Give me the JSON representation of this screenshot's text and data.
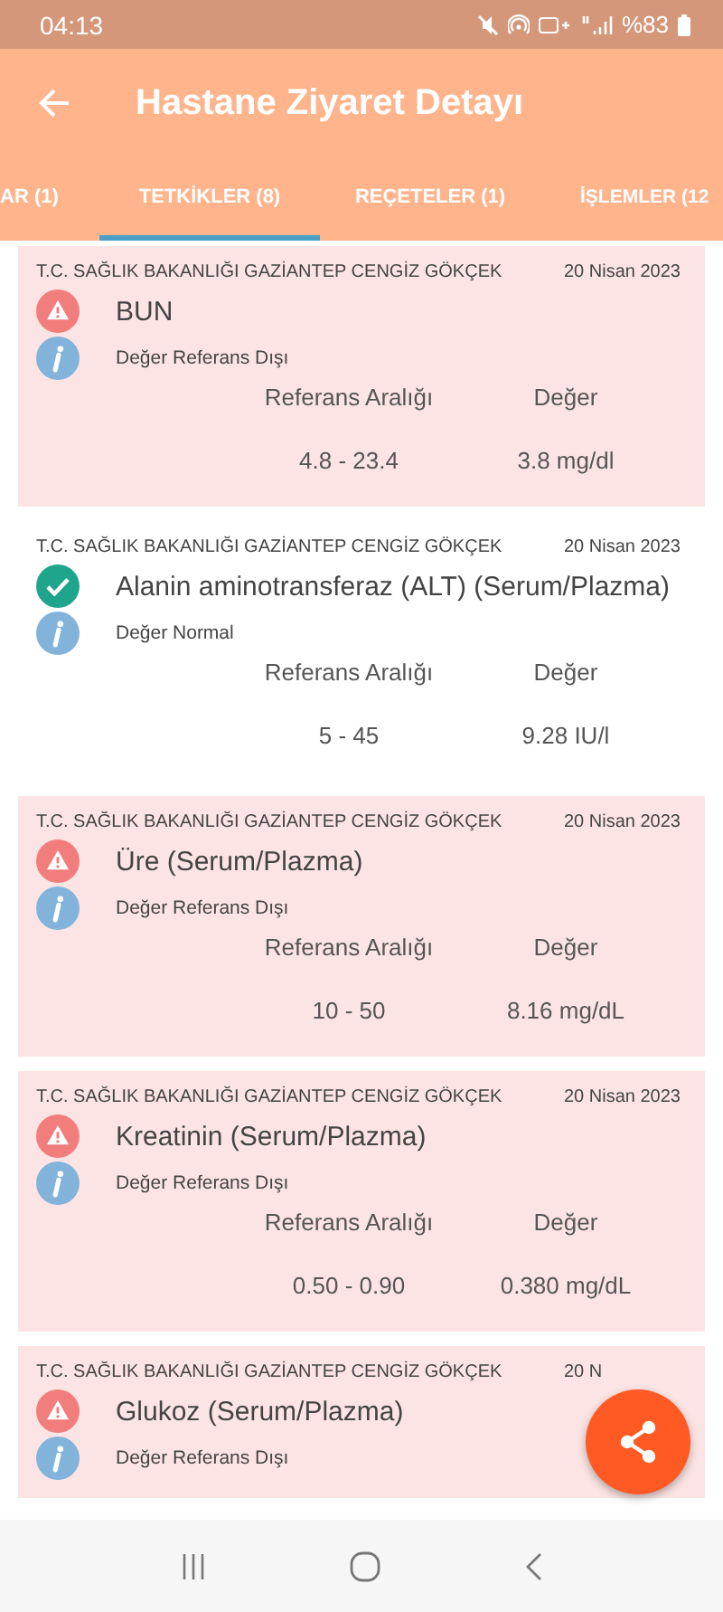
{
  "status_bar": {
    "time": "04:13",
    "battery": "%83"
  },
  "app_bar": {
    "title": "Hastane Ziyaret Detayı"
  },
  "tabs": [
    {
      "label": "AR (1)",
      "selected": false
    },
    {
      "label": "TETKİKLER (8)",
      "selected": true
    },
    {
      "label": "REÇETELER (1)",
      "selected": false
    },
    {
      "label": "İŞLEMLER (12",
      "selected": false
    }
  ],
  "results": [
    {
      "hospital": "T.C. SAĞLIK BAKANLIĞI GAZİANTEP CENGİZ GÖKÇEK",
      "date": "20 Nisan 2023",
      "test": "BUN",
      "kind": "warning",
      "status": "Değer Referans Dışı",
      "range_label": "Referans Aralığı",
      "value_label": "Değer",
      "range": "4.8 - 23.4",
      "value": "3.8 mg/dl"
    },
    {
      "hospital": "T.C. SAĞLIK BAKANLIĞI GAZİANTEP CENGİZ GÖKÇEK",
      "date": "20 Nisan 2023",
      "test": "Alanin aminotransferaz (ALT) (Serum/Plazma)",
      "kind": "normal",
      "status": "Değer Normal",
      "range_label": "Referans Aralığı",
      "value_label": "Değer",
      "range": "5 - 45",
      "value": "9.28 IU/l"
    },
    {
      "hospital": "T.C. SAĞLIK BAKANLIĞI GAZİANTEP CENGİZ GÖKÇEK",
      "date": "20 Nisan 2023",
      "test": "Üre (Serum/Plazma)",
      "kind": "warning",
      "status": "Değer Referans Dışı",
      "range_label": "Referans Aralığı",
      "value_label": "Değer",
      "range": "10 - 50",
      "value": "8.16 mg/dL"
    },
    {
      "hospital": "T.C. SAĞLIK BAKANLIĞI GAZİANTEP CENGİZ GÖKÇEK",
      "date": "20 Nisan 2023",
      "test": "Kreatinin (Serum/Plazma)",
      "kind": "warning",
      "status": "Değer Referans Dışı",
      "range_label": "Referans Aralığı",
      "value_label": "Değer",
      "range": "0.50 - 0.90",
      "value": "0.380 mg/dL"
    },
    {
      "hospital": "T.C. SAĞLIK BAKANLIĞI GAZİANTEP CENGİZ GÖKÇEK",
      "date": "20 N",
      "test": "Glukoz (Serum/Plazma)",
      "kind": "warning",
      "status": "Değer Referans Dışı"
    }
  ]
}
